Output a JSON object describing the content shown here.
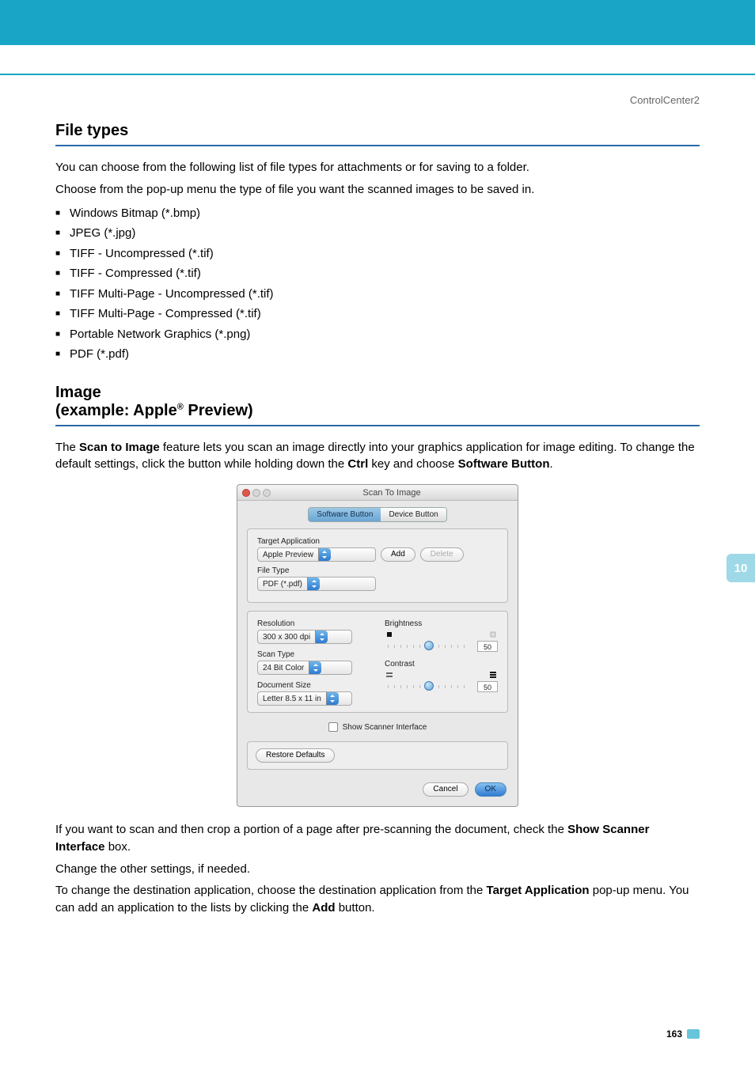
{
  "context": "ControlCenter2",
  "section1": {
    "title": "File types",
    "intro1": "You can choose from the following list of file types for attachments or for saving to a folder.",
    "intro2": "Choose from the pop-up menu the type of file you want the scanned images to be saved in.",
    "items": [
      "Windows Bitmap (*.bmp)",
      "JPEG (*.jpg)",
      "TIFF - Uncompressed (*.tif)",
      "TIFF - Compressed (*.tif)",
      "TIFF Multi-Page - Uncompressed (*.tif)",
      "TIFF Multi-Page - Compressed (*.tif)",
      "Portable Network Graphics (*.png)",
      "PDF (*.pdf)"
    ]
  },
  "section2": {
    "title_line1": "Image",
    "title_line2_pre": "(example: Apple",
    "title_line2_sup": "®",
    "title_line2_post": " Preview)",
    "para1_pre": "The ",
    "para1_bold1": "Scan to Image",
    "para1_mid": " feature lets you scan an image directly into your graphics application for image editing. To change the default settings, click the button while holding down the ",
    "para1_bold2": "Ctrl",
    "para1_mid2": " key and choose ",
    "para1_bold3": "Software Button",
    "para1_end": "."
  },
  "dialog": {
    "title": "Scan To Image",
    "tabs": {
      "software": "Software Button",
      "device": "Device Button"
    },
    "target_app_label": "Target Application",
    "target_app_value": "Apple Preview",
    "add": "Add",
    "delete": "Delete",
    "file_type_label": "File Type",
    "file_type_value": "PDF (*.pdf)",
    "resolution_label": "Resolution",
    "resolution_value": "300 x 300 dpi",
    "scan_type_label": "Scan Type",
    "scan_type_value": "24 Bit Color",
    "doc_size_label": "Document Size",
    "doc_size_value": "Letter  8.5 x 11 in",
    "brightness_label": "Brightness",
    "brightness_value": "50",
    "contrast_label": "Contrast",
    "contrast_value": "50",
    "show_scanner": "Show Scanner Interface",
    "restore": "Restore Defaults",
    "cancel": "Cancel",
    "ok": "OK"
  },
  "after": {
    "p1_pre": "If you want to scan and then crop a portion of a page after pre-scanning the document, check the ",
    "p1_bold": "Show Scanner Interface",
    "p1_post": " box.",
    "p2": "Change the other settings, if needed.",
    "p3_pre": "To change the destination application, choose the destination application from the ",
    "p3_bold1": "Target Application",
    "p3_mid": " pop-up menu. You can add an application to the lists by clicking the ",
    "p3_bold2": "Add",
    "p3_post": " button."
  },
  "sidetab": "10",
  "pagenum": "163"
}
